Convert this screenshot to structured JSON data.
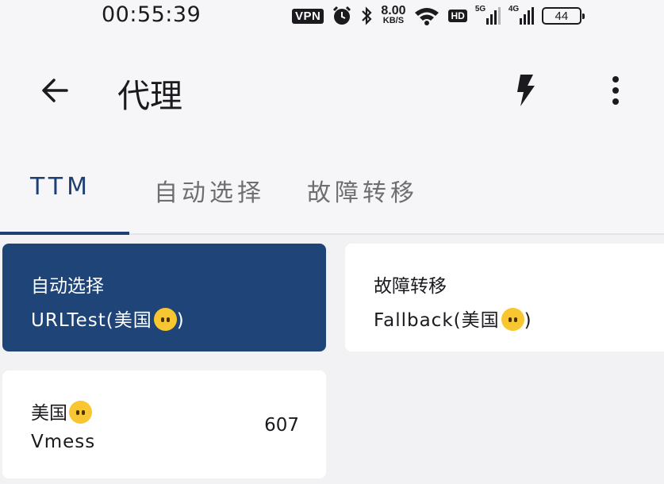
{
  "status_bar": {
    "time": "00:55:39",
    "vpn": "VPN",
    "speed_value": "8.00",
    "speed_unit": "KB/S",
    "hd": "HD",
    "net1": "5G",
    "net2": "4G",
    "battery": "44"
  },
  "header": {
    "title": "代理"
  },
  "tabs": [
    {
      "label": "TTM",
      "active": true
    },
    {
      "label": "自动选择",
      "active": false
    },
    {
      "label": "故障转移",
      "active": false
    }
  ],
  "proxies": [
    {
      "name": "自动选择",
      "type": "URLTest(美国",
      "type_suffix": ")",
      "selected": true
    },
    {
      "name": "故障转移",
      "type": "Fallback(美国",
      "type_suffix": ")",
      "selected": false
    },
    {
      "name": "美国",
      "type": "Vmess",
      "delay": "607",
      "selected": false
    }
  ],
  "colors": {
    "accent": "#1e3f72",
    "selected_card": "#1e4478",
    "background": "#f2f2f4"
  },
  "icons": {
    "back": "arrow-left-icon",
    "bolt": "lightning-bolt-icon",
    "more": "more-vertical-icon",
    "emoji": "no-mouth-face-emoji"
  }
}
